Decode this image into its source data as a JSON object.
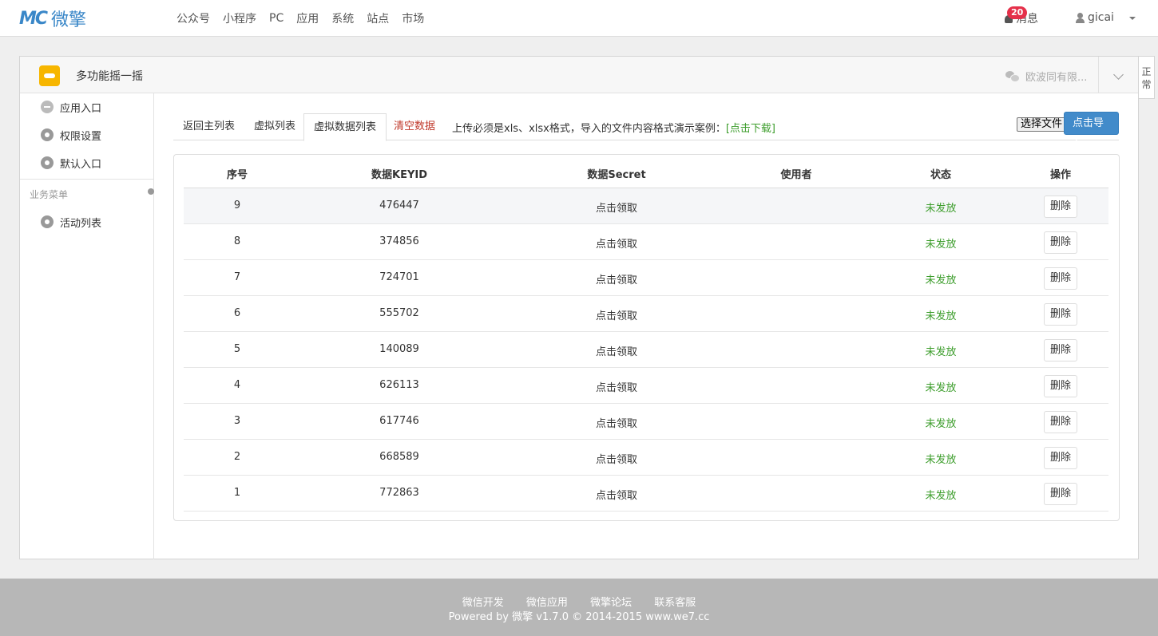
{
  "brand": {
    "mark": "MC",
    "name": "微擎"
  },
  "topnav": [
    "公众号",
    "小程序",
    "PC",
    "应用",
    "系统",
    "站点",
    "市场"
  ],
  "messages": {
    "label": "消息",
    "count": "20"
  },
  "user": {
    "name": "gicai"
  },
  "app": {
    "title": "多功能摇一摇",
    "account": "欧波同有限..."
  },
  "side_tab": "正常",
  "sidebar": {
    "items": [
      {
        "label": "应用入口",
        "icon": "chat-icon"
      },
      {
        "label": "权限设置",
        "icon": "gear-icon"
      },
      {
        "label": "默认入口",
        "icon": "gear-icon"
      }
    ],
    "group_title": "业务菜单",
    "group_items": [
      {
        "label": "活动列表",
        "icon": "gear-icon"
      }
    ]
  },
  "tabs": [
    "返回主列表",
    "虚拟列表",
    "虚拟数据列表",
    "清空数据"
  ],
  "hint": {
    "text": "上传必须是xls、xlsx格式，导入的文件内容格式演示案例：",
    "link": "[点击下载]"
  },
  "file_button": "选择文件",
  "import_button": "点击导入",
  "table": {
    "headers": [
      "序号",
      "数据KEYID",
      "数据Secret",
      "使用者",
      "状态",
      "操作"
    ],
    "rows": [
      {
        "no": "9",
        "keyid": "476447",
        "secret": "点击领取",
        "user": "",
        "status": "未发放",
        "action": "删除"
      },
      {
        "no": "8",
        "keyid": "374856",
        "secret": "点击领取",
        "user": "",
        "status": "未发放",
        "action": "删除"
      },
      {
        "no": "7",
        "keyid": "724701",
        "secret": "点击领取",
        "user": "",
        "status": "未发放",
        "action": "删除"
      },
      {
        "no": "6",
        "keyid": "555702",
        "secret": "点击领取",
        "user": "",
        "status": "未发放",
        "action": "删除"
      },
      {
        "no": "5",
        "keyid": "140089",
        "secret": "点击领取",
        "user": "",
        "status": "未发放",
        "action": "删除"
      },
      {
        "no": "4",
        "keyid": "626113",
        "secret": "点击领取",
        "user": "",
        "status": "未发放",
        "action": "删除"
      },
      {
        "no": "3",
        "keyid": "617746",
        "secret": "点击领取",
        "user": "",
        "status": "未发放",
        "action": "删除"
      },
      {
        "no": "2",
        "keyid": "668589",
        "secret": "点击领取",
        "user": "",
        "status": "未发放",
        "action": "删除"
      },
      {
        "no": "1",
        "keyid": "772863",
        "secret": "点击领取",
        "user": "",
        "status": "未发放",
        "action": "删除"
      }
    ]
  },
  "footer": {
    "links": [
      "微信开发",
      "微信应用",
      "微擎论坛",
      "联系客服"
    ],
    "copyright": "Powered by 微擎 v1.7.0 © 2014-2015 www.we7.cc"
  },
  "colors": {
    "brand": "#3a87c8",
    "primary": "#428bca",
    "success": "#3c9d2b",
    "danger": "#c0392b",
    "badge": "#e5304a"
  }
}
